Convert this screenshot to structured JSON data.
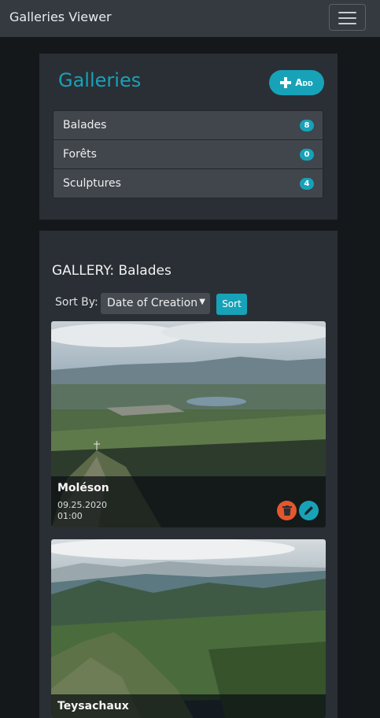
{
  "navbar": {
    "brand": "Galleries Viewer"
  },
  "galleries_panel": {
    "title": "Galleries",
    "add_label": "Add",
    "items": [
      {
        "label": "Balades",
        "count": "8"
      },
      {
        "label": "Forêts",
        "count": "0"
      },
      {
        "label": "Sculptures",
        "count": "4"
      }
    ]
  },
  "gallery": {
    "heading": "GALLERY: Balades",
    "sort_label": "Sort By:",
    "sort_value": "Date of Creation",
    "sort_button": "Sort",
    "cards": [
      {
        "title": "Moléson",
        "date": "09.25.2020",
        "time": "01:00"
      },
      {
        "title": "Teysachaux"
      }
    ]
  },
  "colors": {
    "accent": "#17a2b8",
    "danger": "#e4572e",
    "navbar": "#343a40",
    "panel": "#2a2f35"
  },
  "icons": [
    "menu-icon",
    "plus-icon",
    "trash-icon",
    "pencil-icon",
    "chevron-down-icon"
  ]
}
